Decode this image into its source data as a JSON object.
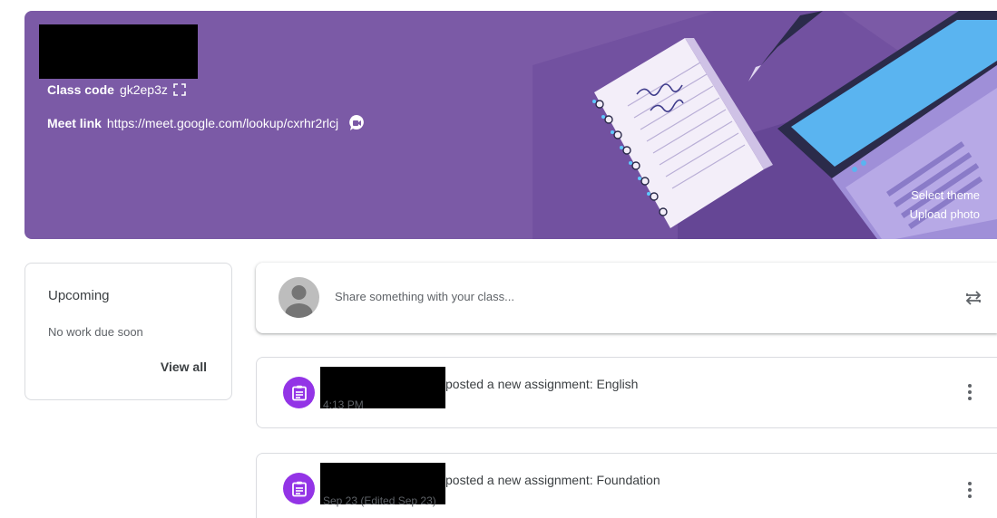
{
  "banner": {
    "class_code_label": "Class code",
    "class_code": "gk2ep3z",
    "meet_link_label": "Meet link",
    "meet_link": "https://meet.google.com/lookup/cxrhr2rlcj",
    "select_theme": "Select theme",
    "upload_photo": "Upload photo",
    "theme_color": "#7b5aa6"
  },
  "upcoming": {
    "title": "Upcoming",
    "status": "No work due soon",
    "view_all": "View all"
  },
  "share": {
    "placeholder": "Share something with your class..."
  },
  "posts": [
    {
      "headline": "posted a new assignment: English",
      "time": "4:13 PM",
      "icon": "assignment-icon"
    },
    {
      "headline": "posted a new assignment: Foundation",
      "time": "Sep 23 (Edited Sep 23)",
      "icon": "assignment-icon"
    }
  ],
  "colors": {
    "accent": "#9334e6"
  }
}
